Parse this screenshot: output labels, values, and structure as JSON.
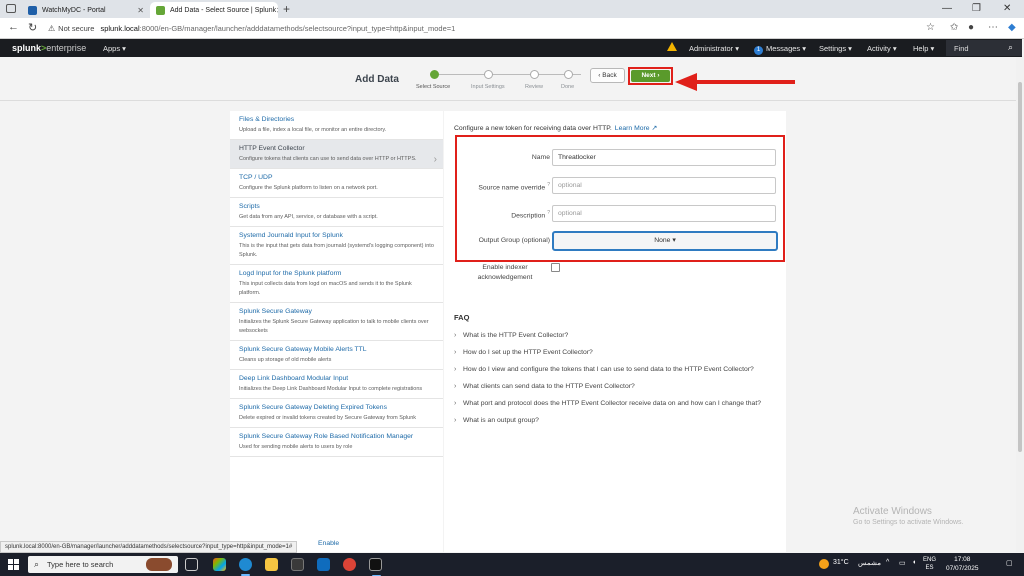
{
  "browser": {
    "tabs": [
      {
        "title": "WatchMyDC - Portal",
        "active": false
      },
      {
        "title": "Add Data - Select Source | Splunk",
        "active": true
      }
    ],
    "url_security": "Not secure",
    "url_host": "splunk.local",
    "url_rest": ":8000/en-GB/manager/launcher/adddatamethods/selectsource?input_type=http&input_mode=1",
    "status_url": "splunk.local:8000/en-GB/manager/launcher/adddatamethods/selectsource?input_type=http&input_mode=1#"
  },
  "splunk_bar": {
    "logo_main": "splunk",
    "logo_sep": ">",
    "logo_product": "enterprise",
    "apps": "Apps ▾",
    "administrator": "Administrator ▾",
    "messages_count": "1",
    "messages": "Messages ▾",
    "settings": "Settings ▾",
    "activity": "Activity ▾",
    "help": "Help ▾",
    "find": "Find"
  },
  "wizard": {
    "title": "Add Data",
    "steps": [
      {
        "label": "Select Source",
        "done": true
      },
      {
        "label": "Input Settings",
        "done": false
      },
      {
        "label": "Review",
        "done": false
      },
      {
        "label": "Done",
        "done": false
      }
    ],
    "back": "‹ Back",
    "next": "Next ›"
  },
  "sources": [
    {
      "title": "Files & Directories",
      "desc": "Upload a file, index a local file, or monitor an entire directory.",
      "selected": false
    },
    {
      "title": "HTTP Event Collector",
      "desc": "Configure tokens that clients can use to send data over HTTP or HTTPS.",
      "selected": true
    },
    {
      "title": "TCP / UDP",
      "desc": "Configure the Splunk platform to listen on a network port.",
      "selected": false
    },
    {
      "title": "Scripts",
      "desc": "Get data from any API, service, or database with a script.",
      "selected": false
    },
    {
      "title": "Systemd Journald Input for Splunk",
      "desc": "This is the input that gets data from journald (systemd's logging component) into Splunk.",
      "selected": false
    },
    {
      "title": "Logd Input for the Splunk platform",
      "desc": "This input collects data from logd on macOS and sends it to the Splunk platform.",
      "selected": false
    },
    {
      "title": "Splunk Secure Gateway",
      "desc": "Initializes the Splunk Secure Gateway application to talk to mobile clients over websockets",
      "selected": false
    },
    {
      "title": "Splunk Secure Gateway Mobile Alerts TTL",
      "desc": "Cleans up storage of old mobile alerts",
      "selected": false
    },
    {
      "title": "Deep Link Dashboard Modular Input",
      "desc": "Initializes the Deep Link Dashboard Modular Input to complete registrations",
      "selected": false
    },
    {
      "title": "Splunk Secure Gateway Deleting Expired Tokens",
      "desc": "Delete expired or invalid tokens created by Secure Gateway from Splunk",
      "selected": false
    },
    {
      "title": "Splunk Secure Gateway Role Based Notification Manager",
      "desc": "Used for sending mobile alerts to users by role",
      "selected": false
    }
  ],
  "partial_item": "Enable",
  "form": {
    "intro": "Configure a new token for receiving data over HTTP.",
    "learn_more": "Learn More ↗",
    "name_label": "Name",
    "name_value": "Threatlocker",
    "source_label": "Source name override",
    "source_placeholder": "optional",
    "desc_label": "Description",
    "desc_placeholder": "optional",
    "help_mark": "?",
    "output_label": "Output Group (optional)",
    "output_value": "None ▾",
    "ack_label": "Enable indexer acknowledgement"
  },
  "faq": {
    "title": "FAQ",
    "items": [
      "What is the HTTP Event Collector?",
      "How do I set up the HTTP Event Collector?",
      "How do I view and configure the tokens that I can use to send data to the HTTP Event Collector?",
      "What clients can send data to the HTTP Event Collector?",
      "What port and protocol does the HTTP Event Collector receive data on and how can I change that?",
      "What is an output group?"
    ]
  },
  "watermark": {
    "line1": "Activate Windows",
    "line2": "Go to Settings to activate Windows."
  },
  "taskbar": {
    "search": "Type here to search",
    "weather": "31°C",
    "weather_desc": "مشمس",
    "lang": "ENG",
    "lang_sub": "ES",
    "time": "17:08",
    "date": "07/07/2025"
  },
  "colors": {
    "splunk_bar": "#1a1c20",
    "accent_green": "#65a637",
    "link_blue": "#1d6aa8",
    "highlight_red": "#e0201a",
    "select_blue": "#2f7bc1"
  }
}
